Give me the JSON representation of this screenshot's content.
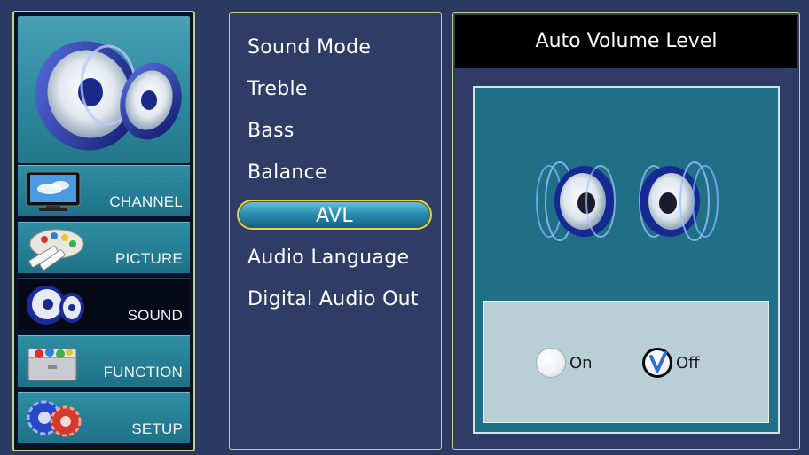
{
  "categories": [
    {
      "label": "CHANNEL",
      "icon": "tv-icon",
      "selected": false
    },
    {
      "label": "PICTURE",
      "icon": "paint-palette-icon",
      "selected": false
    },
    {
      "label": "SOUND",
      "icon": "speaker-icon",
      "selected": true
    },
    {
      "label": "FUNCTION",
      "icon": "toolbox-icon",
      "selected": false
    },
    {
      "label": "SETUP",
      "icon": "gears-icon",
      "selected": false
    }
  ],
  "menu": {
    "items": [
      "Sound Mode",
      "Treble",
      "Bass",
      "Balance",
      "AVL",
      "Audio Language",
      "Digital Audio Out"
    ],
    "selected_index": 4
  },
  "detail": {
    "title": "Auto Volume Level",
    "options": [
      {
        "label": "On",
        "checked": false
      },
      {
        "label": "Off",
        "checked": true
      }
    ]
  },
  "colors": {
    "background": "#2b3a63",
    "panel_border": "#c7cf84",
    "highlight_border": "#e7d14a",
    "teal": "#1f6f86"
  }
}
